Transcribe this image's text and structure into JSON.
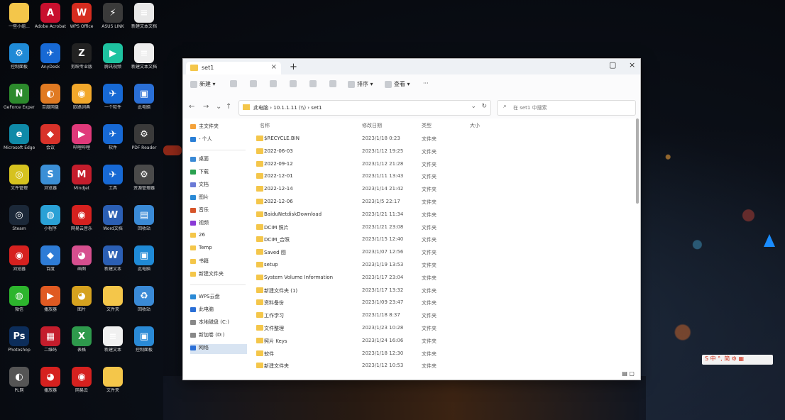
{
  "desktop": {
    "icons": [
      {
        "label": "一些小组...",
        "color": "#f4c64a",
        "glyph": ""
      },
      {
        "label": "Adobe Acrobat DC",
        "color": "#c8102e",
        "glyph": "A"
      },
      {
        "label": "WPS Office",
        "color": "#d62c1f",
        "glyph": "W"
      },
      {
        "label": "ASUS LINK",
        "color": "#3a3a3a",
        "glyph": "⚡"
      },
      {
        "label": "新建文本文档",
        "color": "#e8e8e8",
        "glyph": "≡"
      },
      {
        "label": "控制面板",
        "color": "#1f8ad6",
        "glyph": "⚙"
      },
      {
        "label": "AnyDesk",
        "color": "#1769d4",
        "glyph": "✈"
      },
      {
        "label": "剪映专业版",
        "color": "#222222",
        "glyph": "Z"
      },
      {
        "label": "腾讯视频",
        "color": "#1ec3a0",
        "glyph": "▶"
      },
      {
        "label": "新建文本文档",
        "color": "#eeeeee",
        "glyph": "≡"
      },
      {
        "label": "GeForce Experience",
        "color": "#2c8a2c",
        "glyph": "N"
      },
      {
        "label": "百度网盘",
        "color": "#e07a22",
        "glyph": "◐"
      },
      {
        "label": "欧路词典",
        "color": "#f2a82b",
        "glyph": "◉"
      },
      {
        "label": "一个软件",
        "color": "#1769d4",
        "glyph": "✈"
      },
      {
        "label": "此电脑",
        "color": "#2a6fd6",
        "glyph": "▣"
      },
      {
        "label": "Microsoft Edge",
        "color": "#0f8aa8",
        "glyph": "e"
      },
      {
        "label": "会议",
        "color": "#d8322a",
        "glyph": "◆"
      },
      {
        "label": "哔哩哔哩",
        "color": "#e0397a",
        "glyph": "▶"
      },
      {
        "label": "软件",
        "color": "#1769d4",
        "glyph": "✈"
      },
      {
        "label": "PDF Reader",
        "color": "#3a3a3a",
        "glyph": "⚙"
      },
      {
        "label": "文件管理",
        "color": "#d6c21f",
        "glyph": "◎"
      },
      {
        "label": "浏览器",
        "color": "#3b8fd6",
        "glyph": "S"
      },
      {
        "label": "MindJet",
        "color": "#c41d2c",
        "glyph": "M"
      },
      {
        "label": "工具",
        "color": "#1769d4",
        "glyph": "✈"
      },
      {
        "label": "资源管理器",
        "color": "#4a4a4a",
        "glyph": "⚙"
      },
      {
        "label": "Steam",
        "color": "#1b2838",
        "glyph": "◎"
      },
      {
        "label": "小程序",
        "color": "#2aa1d6",
        "glyph": "◍"
      },
      {
        "label": "网易云音乐",
        "color": "#d6211f",
        "glyph": "◉"
      },
      {
        "label": "Word文档",
        "color": "#2b5fb4",
        "glyph": "W"
      },
      {
        "label": "回收站",
        "color": "#3a8ad6",
        "glyph": "▤"
      },
      {
        "label": "浏览器",
        "color": "#d6211f",
        "glyph": "◉"
      },
      {
        "label": "百度",
        "color": "#2e7cd6",
        "glyph": "◆"
      },
      {
        "label": "画图",
        "color": "#d64f8f",
        "glyph": "◕"
      },
      {
        "label": "新建文本",
        "color": "#2b5fb4",
        "glyph": "W"
      },
      {
        "label": "此电脑",
        "color": "#1f8ad6",
        "glyph": "▣"
      },
      {
        "label": "微信",
        "color": "#2db52d",
        "glyph": "◍"
      },
      {
        "label": "播放器",
        "color": "#e05a22",
        "glyph": "▶"
      },
      {
        "label": "图片",
        "color": "#d6a21f",
        "glyph": "◕"
      },
      {
        "label": "文件夹",
        "color": "#f4c64a",
        "glyph": ""
      },
      {
        "label": "回收站",
        "color": "#3a8ad6",
        "glyph": "♻"
      },
      {
        "label": "Photoshop",
        "color": "#0c2d5a",
        "glyph": "Ps"
      },
      {
        "label": "二维码",
        "color": "#c41d2c",
        "glyph": "▦"
      },
      {
        "label": "表格",
        "color": "#2e9a4c",
        "glyph": "X"
      },
      {
        "label": "新建文本",
        "color": "#f0f0f0",
        "glyph": "≡"
      },
      {
        "label": "控制面板",
        "color": "#2a8ad6",
        "glyph": "▣"
      },
      {
        "label": "PL网",
        "color": "#555555",
        "glyph": "◐"
      },
      {
        "label": "播放器",
        "color": "#d6211f",
        "glyph": "◕"
      },
      {
        "label": "网易云",
        "color": "#d6211f",
        "glyph": "◉"
      },
      {
        "label": "文件夹",
        "color": "#f4c64a",
        "glyph": ""
      }
    ]
  },
  "window": {
    "tab_label": "set1",
    "tab_close": "×",
    "new_tab": "+",
    "minimize": "–",
    "maximize": "▢",
    "close": "×",
    "toolbar": {
      "new_label": "新建",
      "sort_label": "排序",
      "view_label": "查看",
      "more_label": "···"
    },
    "address": {
      "crumbs": "此电脑  ›  10.1.1.11 (\\\\)  ›  set1"
    },
    "search_placeholder": "在 set1 中搜索",
    "sidebar": {
      "quick": [
        {
          "label": "主文件夹",
          "color": "#f4a23a"
        },
        {
          "label": "- 个人",
          "color": "#2a7fd6"
        }
      ],
      "pinned": [
        {
          "label": "桌面",
          "color": "#3a8ad6"
        },
        {
          "label": "下载",
          "color": "#2aa150"
        },
        {
          "label": "文档",
          "color": "#6a7ad6"
        },
        {
          "label": "图片",
          "color": "#2a8ad6"
        },
        {
          "label": "音乐",
          "color": "#d6552a"
        },
        {
          "label": "视频",
          "color": "#8a3ad6"
        },
        {
          "label": "26",
          "color": "#f4c64a"
        },
        {
          "label": "Temp",
          "color": "#f4c64a"
        },
        {
          "label": "书籍",
          "color": "#f4c64a"
        },
        {
          "label": "新建文件夹",
          "color": "#f4c64a"
        }
      ],
      "drives": [
        {
          "label": "WPS云盘",
          "color": "#2a8ad6"
        },
        {
          "label": "此电脑",
          "color": "#2a6fd6"
        },
        {
          "label": "本地磁盘 (C:)",
          "color": "#888888"
        },
        {
          "label": "新加卷 (D:)",
          "color": "#888888"
        },
        {
          "label": "网络",
          "color": "#2a6fd6"
        }
      ]
    },
    "columns": {
      "name": "名称",
      "date": "修改日期",
      "type": "类型",
      "size": "大小"
    },
    "files": [
      {
        "name": "$RECYCLE.BIN",
        "date": "2023/1/18 0:23",
        "type": "文件夹"
      },
      {
        "name": "2022-06-03",
        "date": "2023/1/12 19:25",
        "type": "文件夹"
      },
      {
        "name": "2022-09-12",
        "date": "2023/1/12 21:28",
        "type": "文件夹"
      },
      {
        "name": "2022-12-01",
        "date": "2023/1/11 13:43",
        "type": "文件夹"
      },
      {
        "name": "2022-12-14",
        "date": "2023/1/14 21:42",
        "type": "文件夹"
      },
      {
        "name": "2022-12-06",
        "date": "2023/1/5 22:17",
        "type": "文件夹"
      },
      {
        "name": "BaiduNetdiskDownload",
        "date": "2023/1/21 11:34",
        "type": "文件夹"
      },
      {
        "name": "DCIM 照片",
        "date": "2023/1/21 23:08",
        "type": "文件夹"
      },
      {
        "name": "DCIM_合照",
        "date": "2023/1/15 12:40",
        "type": "文件夹"
      },
      {
        "name": "Saved 图",
        "date": "2023/1/07 12:56",
        "type": "文件夹"
      },
      {
        "name": "setup",
        "date": "2023/1/19 13:53",
        "type": "文件夹"
      },
      {
        "name": "System Volume Information",
        "date": "2023/1/17 23:04",
        "type": "文件夹"
      },
      {
        "name": "新建文件夹 (1)",
        "date": "2023/1/17 13:32",
        "type": "文件夹"
      },
      {
        "name": "资料备份",
        "date": "2023/1/09 23:47",
        "type": "文件夹"
      },
      {
        "name": "工作学习",
        "date": "2023/1/18 8:37",
        "type": "文件夹"
      },
      {
        "name": "文件整理",
        "date": "2023/1/23 10:28",
        "type": "文件夹"
      },
      {
        "name": "照片 Keys",
        "date": "2023/1/24 16:06",
        "type": "文件夹"
      },
      {
        "name": "软件",
        "date": "2023/1/18 12:30",
        "type": "文件夹"
      },
      {
        "name": "新建文件夹",
        "date": "2023/1/12 10:53",
        "type": "文件夹"
      }
    ]
  },
  "ime": {
    "label": "S 中 °, 简 ⚙ ▦"
  }
}
